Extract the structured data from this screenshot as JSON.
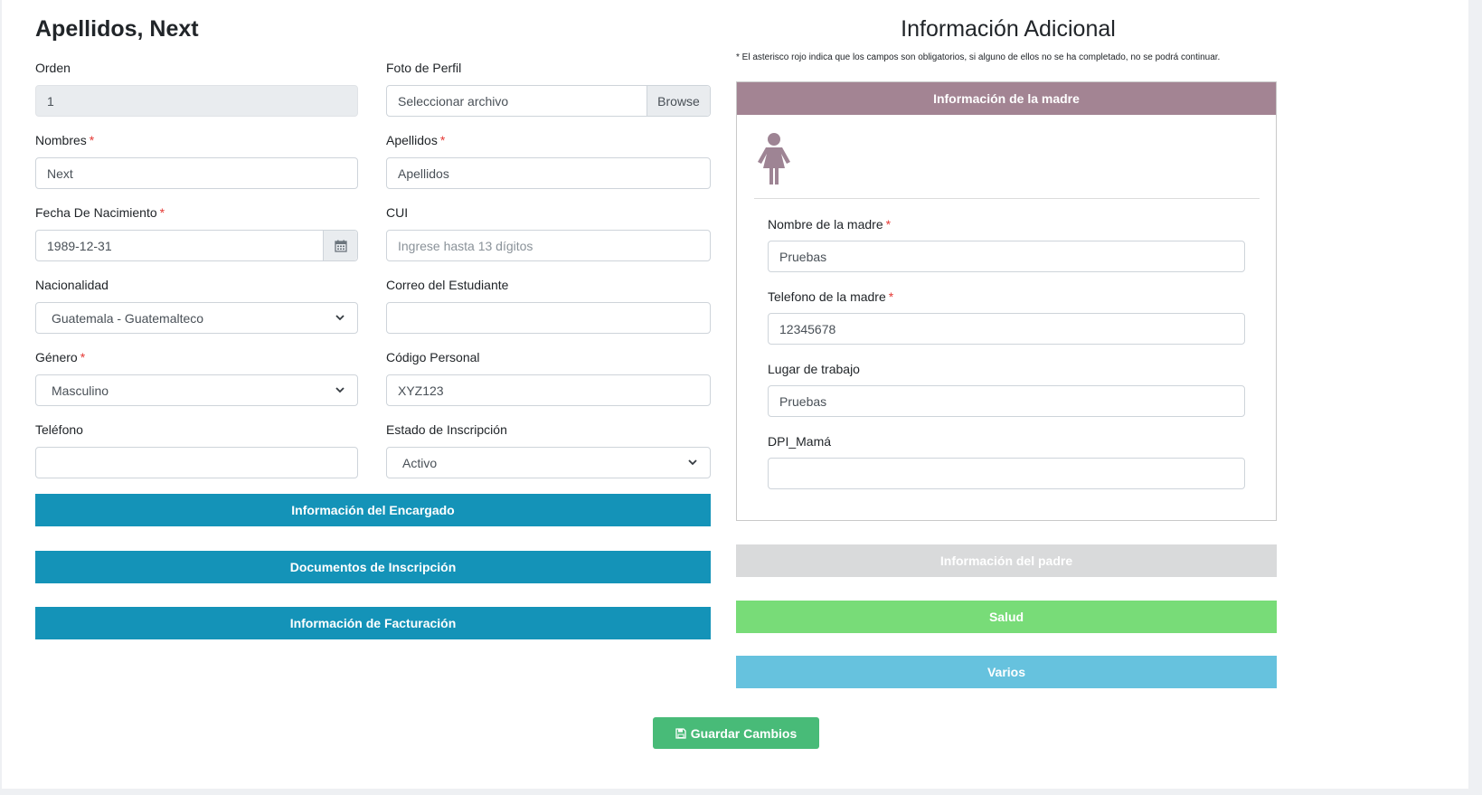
{
  "header": {
    "title": "Apellidos, Next"
  },
  "form": {
    "orden": {
      "label": "Orden",
      "value": "1"
    },
    "foto": {
      "label": "Foto de Perfil",
      "placeholder": "Seleccionar archivo",
      "browse_label": "Browse"
    },
    "nombres": {
      "label": "Nombres",
      "required_mark": "*",
      "value": "Next"
    },
    "apellidos": {
      "label": "Apellidos",
      "required_mark": "*",
      "value": "Apellidos"
    },
    "fecha": {
      "label": "Fecha De Nacimiento",
      "required_mark": "*",
      "value": "1989-12-31"
    },
    "cui": {
      "label": "CUI",
      "placeholder": "Ingrese hasta 13 dígitos"
    },
    "nacionalidad": {
      "label": "Nacionalidad",
      "value": "Guatemala - Guatemalteco"
    },
    "correo": {
      "label": "Correo del Estudiante",
      "value": ""
    },
    "genero": {
      "label": "Género",
      "required_mark": "*",
      "value": "Masculino"
    },
    "codigo": {
      "label": "Código Personal",
      "value": "XYZ123"
    },
    "telefono": {
      "label": "Teléfono",
      "value": ""
    },
    "estado": {
      "label": "Estado de Inscripción",
      "value": "Activo"
    }
  },
  "sections_left": {
    "encargado": "Información del Encargado",
    "documentos": "Documentos de Inscripción",
    "facturacion": "Información de Facturación"
  },
  "additional": {
    "title": "Información Adicional",
    "note": "*  El asterisco rojo indica que los campos son obligatorios, si alguno de ellos no se ha completado, no se podrá continuar.",
    "mother": {
      "header": "Información de la madre",
      "nombre": {
        "label": "Nombre de la madre",
        "required_mark": "*",
        "value": "Pruebas"
      },
      "telefono": {
        "label": "Telefono de la madre",
        "required_mark": "*",
        "value": "12345678"
      },
      "lugar": {
        "label": "Lugar de trabajo",
        "value": "Pruebas"
      },
      "dpi": {
        "label": "DPI_Mamá",
        "value": ""
      }
    },
    "padre": "Información del padre",
    "salud": "Salud",
    "varios": "Varios"
  },
  "actions": {
    "save_label": "Guardar Cambios"
  },
  "colors": {
    "section_blue": "#1493b8",
    "mother_header": "#a38493",
    "padre_bar": "#d9dadb",
    "salud_bar": "#78dc78",
    "varios_bar": "#66c2de",
    "save_button": "#48bb78"
  },
  "icons": {
    "mother": "female-person-icon",
    "calendar": "calendar-icon",
    "chevron": "chevron-down-icon",
    "save": "floppy-disk-icon"
  }
}
